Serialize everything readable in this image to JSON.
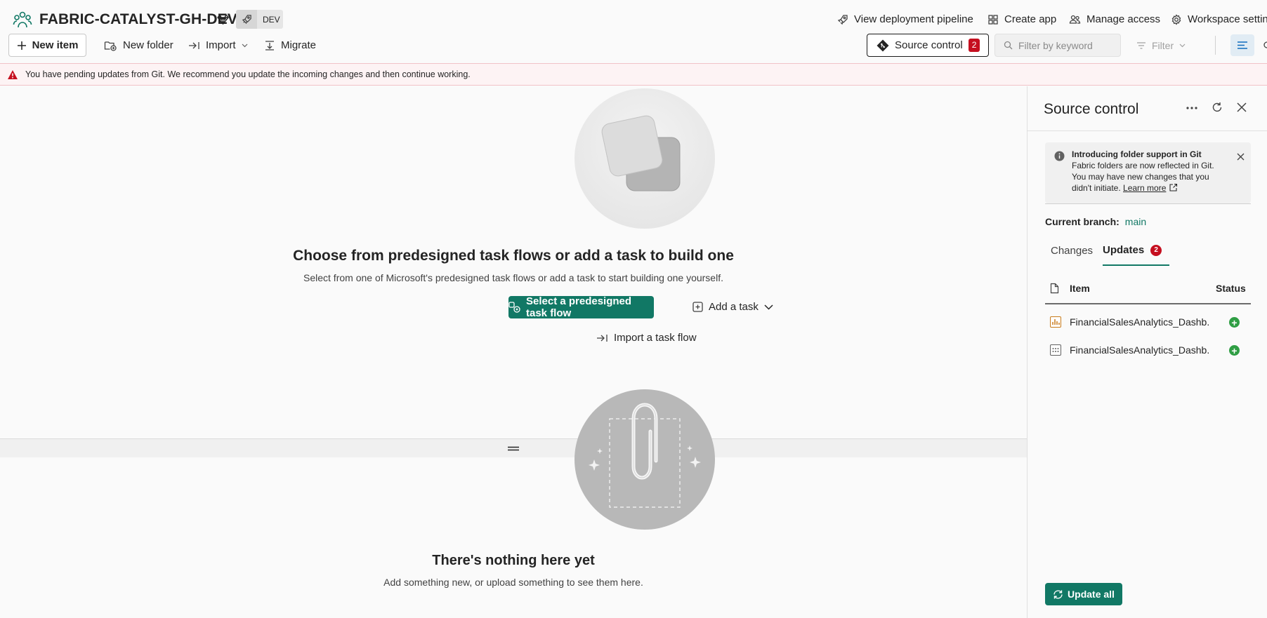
{
  "header": {
    "workspace_title": "FABRIC-CATALYST-GH-DEV",
    "stage_badge": "DEV",
    "links": [
      {
        "label": "View deployment pipeline",
        "icon": "rocket-icon"
      },
      {
        "label": "Create app",
        "icon": "app-icon"
      },
      {
        "label": "Manage access",
        "icon": "people-icon"
      },
      {
        "label": "Workspace settings",
        "icon": "gear-icon"
      }
    ]
  },
  "toolbar": {
    "new_item": "New item",
    "new_folder": "New folder",
    "import": "Import",
    "migrate": "Migrate",
    "source_control": "Source control",
    "source_control_count": "2",
    "filter_placeholder": "Filter by keyword",
    "filter": "Filter"
  },
  "warning": {
    "text": "You have pending updates from Git. We recommend you update the incoming changes and then continue working."
  },
  "task_flow": {
    "heading": "Choose from predesigned task flows or add a task to build one",
    "subtext": "Select from one of Microsoft's predesigned task flows or add a task to start building one yourself.",
    "select_button": "Select a predesigned task flow",
    "add_task": "Add a task",
    "import_flow": "Import a task flow"
  },
  "empty_state": {
    "heading": "There's nothing here yet",
    "subtext": "Add something new, or upload something to see them here."
  },
  "panel": {
    "title": "Source control",
    "info": {
      "bold": "Introducing folder support in Git",
      "text": "Fabric folders are now reflected in Git. You may have new changes that you didn't initiate.",
      "link": "Learn more"
    },
    "branch_label": "Current branch:",
    "branch_name": "main",
    "tabs": {
      "changes": "Changes",
      "updates": "Updates",
      "updates_count": "2"
    },
    "columns": {
      "item": "Item",
      "status": "Status"
    },
    "rows": [
      {
        "name": "FinancialSalesAnalytics_Dashb...",
        "icon": "report-icon",
        "status": "added"
      },
      {
        "name": "FinancialSalesAnalytics_Dashb...",
        "icon": "semantic-model-icon",
        "status": "added"
      }
    ],
    "update_all": "Update all"
  },
  "colors": {
    "accent": "#117865",
    "alert": "#c50f1f",
    "added": "#2f9e44"
  }
}
